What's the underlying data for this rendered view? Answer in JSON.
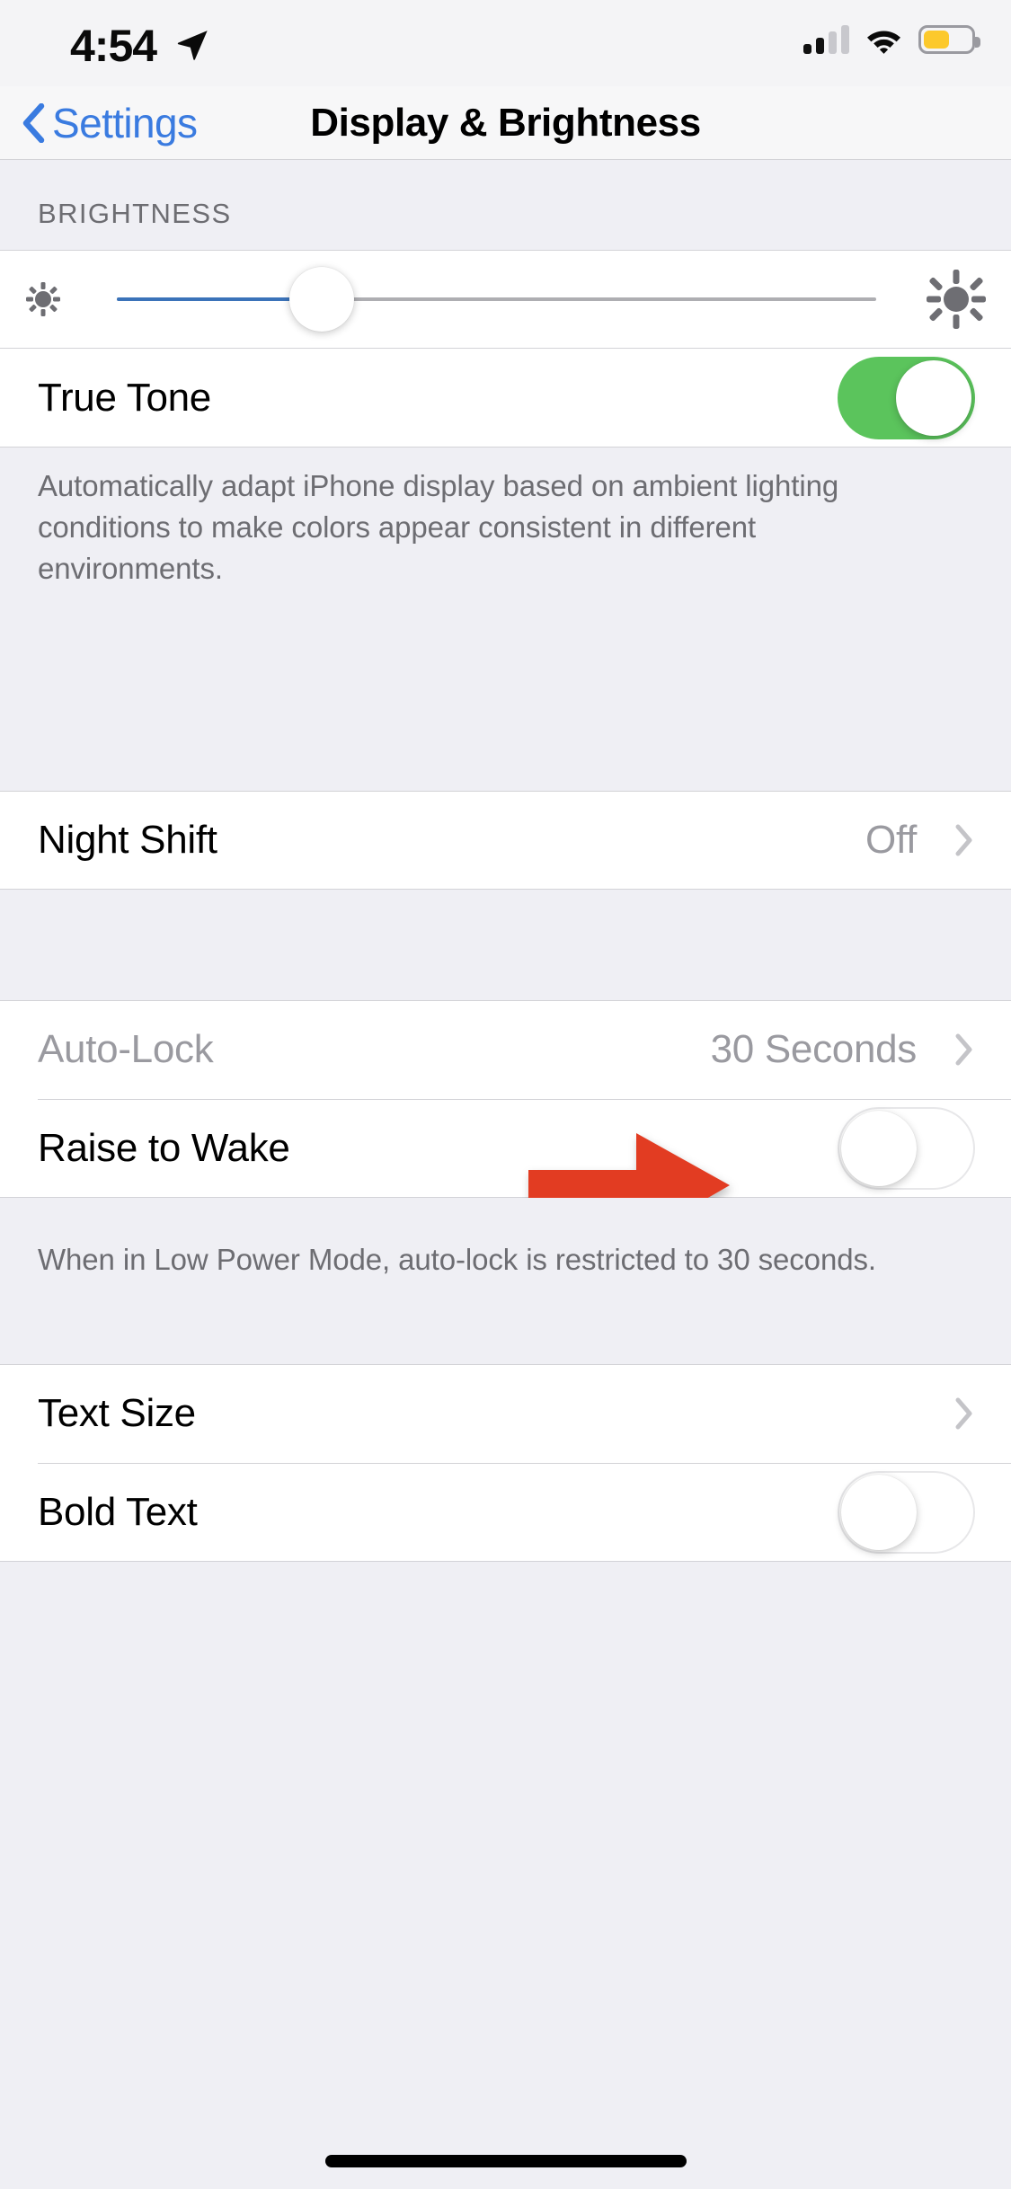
{
  "status_bar": {
    "time": "4:54",
    "location_icon": "location-arrow-icon",
    "cellular_icon": "cellular-signal-icon",
    "cellular_bars_filled": 2,
    "cellular_bars_total": 4,
    "wifi_icon": "wifi-icon",
    "battery_icon": "battery-icon",
    "battery_level_percent": 50,
    "battery_color": "#FCC92C"
  },
  "nav": {
    "back_label": "Settings",
    "back_icon": "chevron-left-icon",
    "title": "Display & Brightness",
    "tint_color": "#3A7BE0"
  },
  "sections": {
    "brightness": {
      "header": "BRIGHTNESS",
      "slider": {
        "name": "brightness-slider",
        "value_percent": 27,
        "min_icon": "sun-small-icon",
        "max_icon": "sun-large-icon",
        "fill_color": "#3B73B9",
        "track_color": "#AEAEB2"
      },
      "true_tone": {
        "label": "True Tone",
        "toggle_state": "on",
        "toggle_on_color": "#5BC45C"
      },
      "footer": "Automatically adapt iPhone display based on ambient lighting conditions to make colors appear consistent in different environments."
    },
    "night_shift": {
      "label": "Night Shift",
      "value": "Off",
      "disclosure_icon": "chevron-right-icon"
    },
    "lock": {
      "auto_lock": {
        "label": "Auto-Lock",
        "value": "30 Seconds",
        "disabled": true,
        "disclosure_icon": "chevron-right-icon"
      },
      "raise_to_wake": {
        "label": "Raise to Wake",
        "toggle_state": "off"
      },
      "footer": "When in Low Power Mode, auto-lock is restricted to 30 seconds."
    },
    "text": {
      "text_size": {
        "label": "Text Size",
        "disclosure_icon": "chevron-right-icon"
      },
      "bold_text": {
        "label": "Bold Text",
        "toggle_state": "off"
      }
    }
  },
  "annotation": {
    "name": "red-arrow-annotation",
    "points_at": "raise-to-wake-toggle",
    "color": "#E23C22"
  },
  "home_indicator": "home-indicator"
}
